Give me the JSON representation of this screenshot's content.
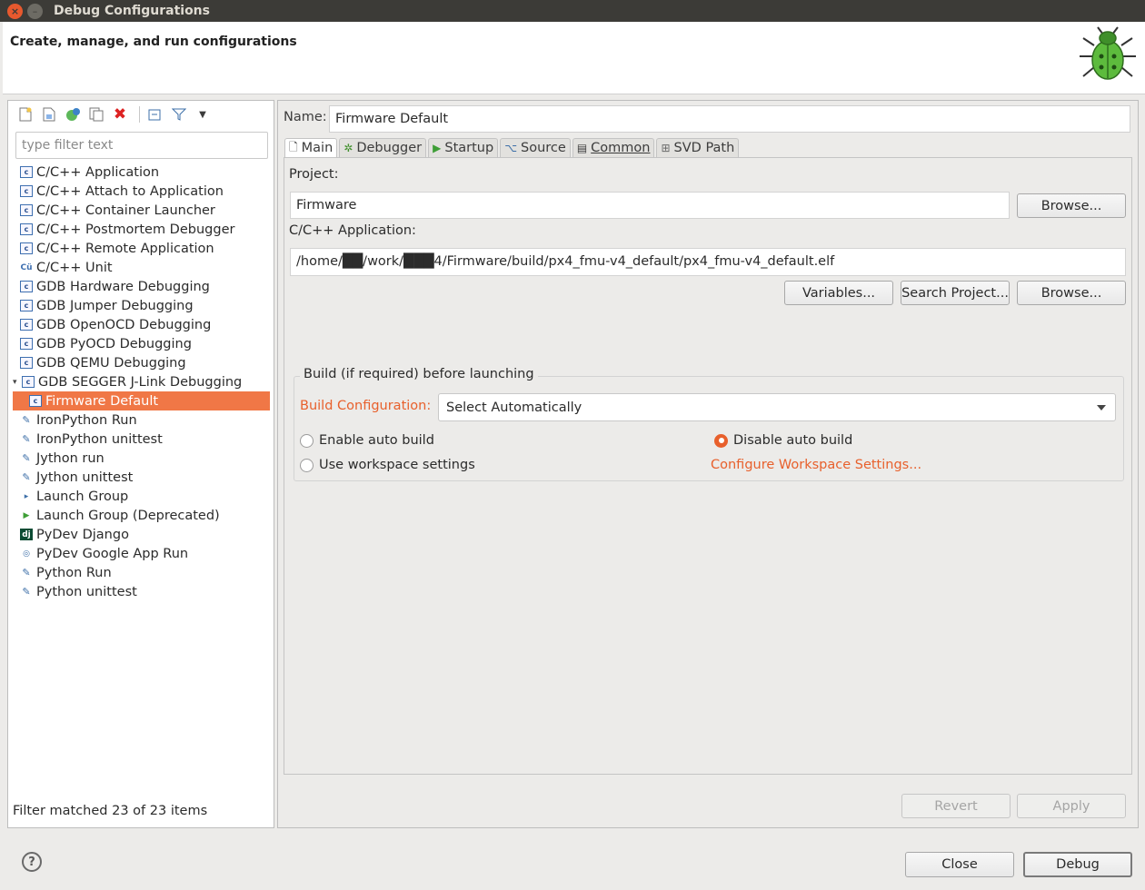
{
  "window": {
    "title": "Debug Configurations"
  },
  "header": {
    "title": "Create, manage, and run configurations",
    "icon": "bug-icon"
  },
  "left": {
    "toolbar": [
      "new-config-icon",
      "new-prototype-icon",
      "export-icon",
      "duplicate-icon",
      "delete-icon",
      "collapse-all-icon",
      "filter-icon",
      "dropdown-icon"
    ],
    "filter_placeholder": "type filter text",
    "items": [
      {
        "label": "C/C++ Application",
        "icon": "c-icon"
      },
      {
        "label": "C/C++ Attach to Application",
        "icon": "c-icon"
      },
      {
        "label": "C/C++ Container Launcher",
        "icon": "c-icon"
      },
      {
        "label": "C/C++ Postmortem Debugger",
        "icon": "c-icon"
      },
      {
        "label": "C/C++ Remote Application",
        "icon": "c-icon"
      },
      {
        "label": "C/C++ Unit",
        "icon": "cu-icon"
      },
      {
        "label": "GDB Hardware Debugging",
        "icon": "c-icon"
      },
      {
        "label": "GDB Jumper Debugging",
        "icon": "c-icon"
      },
      {
        "label": "GDB OpenOCD Debugging",
        "icon": "c-icon"
      },
      {
        "label": "GDB PyOCD Debugging",
        "icon": "c-icon"
      },
      {
        "label": "GDB QEMU Debugging",
        "icon": "c-icon"
      },
      {
        "label": "GDB SEGGER J-Link Debugging",
        "icon": "c-icon"
      },
      {
        "label": "Firmware Default",
        "icon": "c-icon"
      },
      {
        "label": "IronPython Run",
        "icon": "python-icon"
      },
      {
        "label": "IronPython unittest",
        "icon": "python-icon"
      },
      {
        "label": "Jython run",
        "icon": "python-icon"
      },
      {
        "label": "Jython unittest",
        "icon": "python-icon"
      },
      {
        "label": "Launch Group",
        "icon": "launch-icon"
      },
      {
        "label": "Launch Group (Deprecated)",
        "icon": "play-icon"
      },
      {
        "label": "PyDev Django",
        "icon": "django-icon"
      },
      {
        "label": "PyDev Google App Run",
        "icon": "google-icon"
      },
      {
        "label": "Python Run",
        "icon": "python-icon"
      },
      {
        "label": "Python unittest",
        "icon": "python-icon"
      }
    ],
    "status": "Filter matched 23 of 23 items"
  },
  "main": {
    "name_label": "Name:",
    "name_value": "Firmware Default",
    "tabs": [
      {
        "label": "Main"
      },
      {
        "label": "Debugger"
      },
      {
        "label": "Startup"
      },
      {
        "label": "Source"
      },
      {
        "label": "Common"
      },
      {
        "label": "SVD Path"
      }
    ],
    "project_label": "Project:",
    "project_value": "Firmware",
    "browse_label": "Browse...",
    "app_label": "C/C++ Application:",
    "app_value": "/home/██/work/███4/Firmware/build/px4_fmu-v4_default/px4_fmu-v4_default.elf",
    "variables_label": "Variables...",
    "search_label": "Search Project...",
    "browse2_label": "Browse...",
    "build_group_title": "Build (if required) before launching",
    "build_config_label": "Build Configuration:",
    "build_config_value": "Select Automatically",
    "enable_auto_build": "Enable auto build",
    "disable_auto_build": "Disable auto build",
    "use_workspace": "Use workspace settings",
    "configure_workspace": "Configure Workspace Settings...",
    "revert_label": "Revert",
    "apply_label": "Apply"
  },
  "footer": {
    "close_label": "Close",
    "debug_label": "Debug",
    "help_label": "?"
  }
}
